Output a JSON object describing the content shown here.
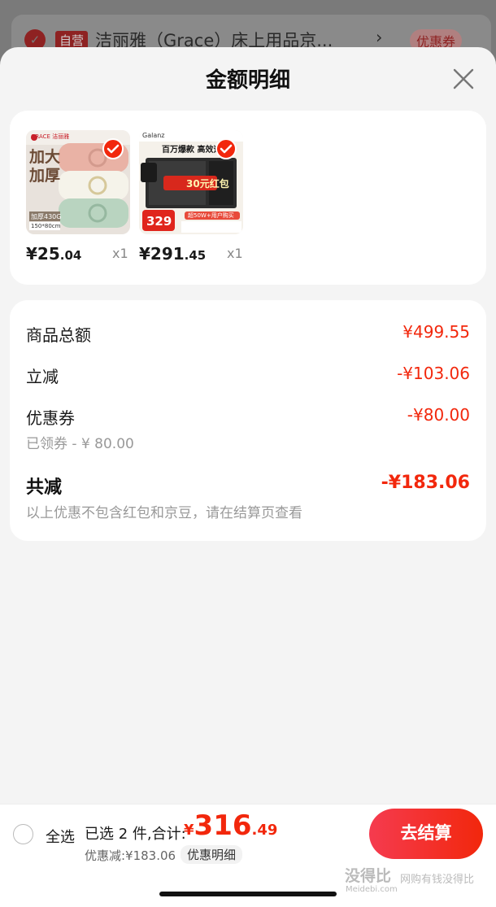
{
  "background_item": {
    "tag": "自营",
    "title": "洁丽雅（Grace）床上用品京...",
    "coupon_label": "优惠券"
  },
  "sheet": {
    "title": "金额明细"
  },
  "products": [
    {
      "brand": "GRACE 洁丽雅",
      "promo_text": "加大加厚",
      "spec_text": "加厚430G",
      "size_text": "150*80cm",
      "price_int": "¥25",
      "price_dec": ".04",
      "qty": "x1"
    },
    {
      "brand": "Galanz",
      "headline": "百万爆款 高效速热",
      "promo_red": "30元红包",
      "promo_price": "329",
      "promo_bottom": "超50W+用户购买",
      "price_int": "¥291",
      "price_dec": ".45",
      "qty": "x1"
    }
  ],
  "summary": {
    "goods_total_label": "商品总额",
    "goods_total_value": "¥499.55",
    "instant_cut_label": "立减",
    "instant_cut_value": "-¥103.06",
    "coupon_label": "优惠券",
    "coupon_value": "-¥80.00",
    "coupon_sub": "已领券 - ¥ 80.00",
    "total_cut_label": "共减",
    "total_cut_value": "-¥183.06",
    "note": "以上优惠不包含红包和京豆，请在结算页查看"
  },
  "bottom_bar": {
    "select_all_label": "全选",
    "selected_text": "已选 2 件,合计:",
    "total_symbol": "¥",
    "total_int": "316",
    "total_dec": ".49",
    "discount_text": "优惠减:¥183.06",
    "detail_chip": "优惠明细",
    "checkout_label": "去结算"
  },
  "watermark": {
    "text": "没得比",
    "sub": "Meidebi.com",
    "slogan": "网购有钱没得比"
  },
  "colors": {
    "accent": "#f2270c",
    "sheet_bg": "#f4f4f4"
  }
}
